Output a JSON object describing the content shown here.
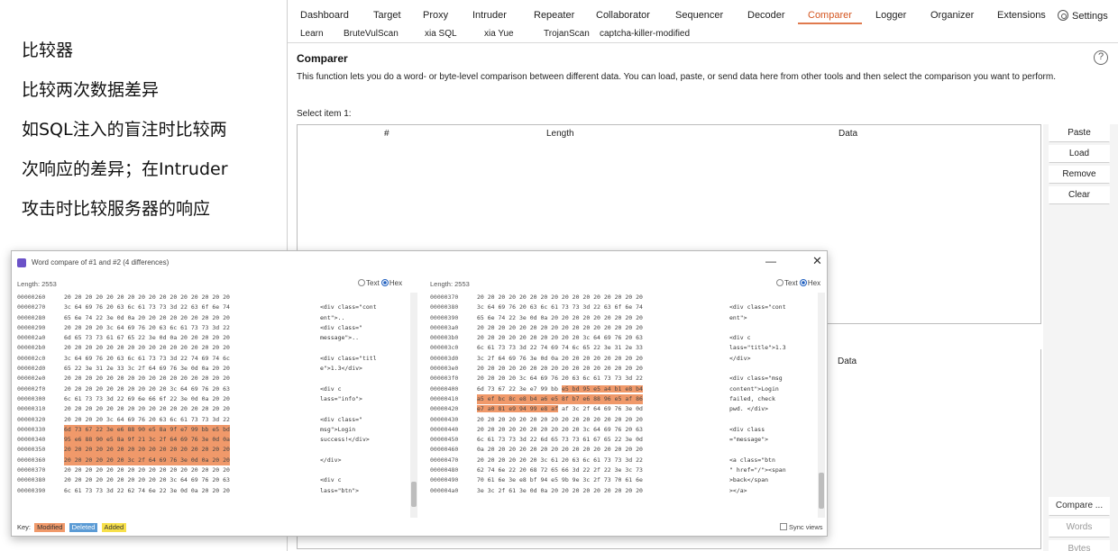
{
  "annotation": {
    "lines": [
      "比较器",
      "比较两次数据差异",
      "如SQL注入的盲注时比较两",
      "次响应的差异；在Intruder",
      "攻击时比较服务器的响应"
    ]
  },
  "tabs_row1": [
    {
      "label": "Dashboard"
    },
    {
      "label": "Target"
    },
    {
      "label": "Proxy"
    },
    {
      "label": "Intruder"
    },
    {
      "label": "Repeater"
    },
    {
      "label": "Collaborator"
    },
    {
      "label": "Sequencer"
    },
    {
      "label": "Decoder"
    },
    {
      "label": "Comparer"
    },
    {
      "label": "Logger"
    },
    {
      "label": "Organizer"
    },
    {
      "label": "Extensions"
    }
  ],
  "active_tab": "Comparer",
  "settings_label": "Settings",
  "tabs_row2": [
    {
      "label": "Learn"
    },
    {
      "label": "BruteVulScan"
    },
    {
      "label": "xia SQL"
    },
    {
      "label": "xia Yue"
    },
    {
      "label": "TrojanScan"
    },
    {
      "label": "captcha-killer-modified"
    }
  ],
  "comparer": {
    "title": "Comparer",
    "description": "This function lets you do a word- or byte-level comparison between different data. You can load, paste, or send data here from other tools and then select the comparison you want to perform.",
    "select_item1_label": "Select item 1:",
    "columns": {
      "num": "#",
      "length": "Length",
      "data": "Data"
    },
    "item2_data_header": "Data",
    "buttons": {
      "paste": "Paste",
      "load": "Load",
      "remove": "Remove",
      "clear": "Clear"
    },
    "compare_label": "Compare ...",
    "words_label": "Words",
    "bytes_label": "Bytes"
  },
  "dialog": {
    "title": "Word compare of #1 and #2 (4 differences)",
    "minimize_glyph": "—",
    "close_glyph": "✕",
    "left": {
      "length_label": "Length: 2553",
      "text_label": "Text",
      "hex_label": "Hex",
      "rows": [
        {
          "off": "00000260",
          "hex": "20 20 20 20 20 20 20 20   20 20 20 20 20 20 20 20",
          "asc": "",
          "hl": false
        },
        {
          "off": "00000270",
          "hex": "3c 64 69 76 20 63 6c 61   73 73 3d 22 63 6f 6e 74",
          "asc": "<div class=\"cont",
          "hl": false
        },
        {
          "off": "00000280",
          "hex": "65 6e 74 22 3e 0d 0a 20   20 20 20 20 20 20 20 20",
          "asc": "ent\">..",
          "hl": false
        },
        {
          "off": "00000290",
          "hex": "20 20 20 20 3c 64 69 76   20 63 6c 61 73 73 3d 22",
          "asc": "    <div class=\"",
          "hl": false
        },
        {
          "off": "000002a0",
          "hex": "6d 65 73 73 61 67 65 22   3e 0d 0a 20 20 20 20 20",
          "asc": "message\">..",
          "hl": false
        },
        {
          "off": "000002b0",
          "hex": "20 20 20 20 20 20 20 20   20 20 20 20 20 20 20 20",
          "asc": "",
          "hl": false
        },
        {
          "off": "000002c0",
          "hex": "3c 64 69 76 20 63 6c 61   73 73 3d 22 74 69 74 6c",
          "asc": "<div class=\"titl",
          "hl": false
        },
        {
          "off": "000002d0",
          "hex": "65 22 3e 31 2e 33 3c 2f   64 69 76 3e 0d 0a 20 20",
          "asc": "e\">1.3</div>",
          "hl": false
        },
        {
          "off": "000002e0",
          "hex": "20 20 20 20 20 20 20 20   20 20 20 20 20 20 20 20",
          "asc": "",
          "hl": false
        },
        {
          "off": "000002f0",
          "hex": "20 20 20 20 20 20 20 20   20 20 3c 64 69 76 20 63",
          "asc": "          <div c",
          "hl": false
        },
        {
          "off": "00000300",
          "hex": "6c 61 73 73 3d 22 69 6e   66 6f 22 3e 0d 0a 20 20",
          "asc": "lass=\"info\">",
          "hl": false
        },
        {
          "off": "00000310",
          "hex": "20 20 20 20 20 20 20 20   20 20 20 20 20 20 20 20",
          "asc": "",
          "hl": false
        },
        {
          "off": "00000320",
          "hex": "20 20 20 20 3c 64 69 76   20 63 6c 61 73 73 3d 22",
          "asc": "    <div class=\"",
          "hl": false
        },
        {
          "off": "00000330",
          "hex": "6d 73 67 22 3e e6 88 90   e5 8a 9f e7 99 bb e5 bd",
          "asc": "msg\">Login",
          "hl": true
        },
        {
          "off": "00000340",
          "hex": "95 e6 88 90 e5 8a 9f 21   3c 2f 64 69 76 3e 0d 0a",
          "asc": "success!</div>",
          "hl": true
        },
        {
          "off": "00000350",
          "hex": "20 20 20 20 20 20 20 20   20 20 20 20 20 20 20 20",
          "asc": "",
          "hl": true
        },
        {
          "off": "00000360",
          "hex": "20 20 20 20 20 20 3c 2f   64 69 76 3e 0d 0a 20 20",
          "asc": "      </div>",
          "hl": true
        },
        {
          "off": "00000370",
          "hex": "20 20 20 20 20 20 20 20   20 20 20 20 20 20 20 20",
          "asc": "",
          "hl": false
        },
        {
          "off": "00000380",
          "hex": "20 20 20 20 20 20 20 20   20 20 3c 64 69 76 20 63",
          "asc": "          <div c",
          "hl": false
        },
        {
          "off": "00000390",
          "hex": "6c 61 73 73 3d 22 62 74   6e 22 3e 0d 0a 20 20 20",
          "asc": "lass=\"btn\">",
          "hl": false
        }
      ]
    },
    "right": {
      "length_label": "Length: 2553",
      "text_label": "Text",
      "hex_label": "Hex",
      "rows": [
        {
          "off": "00000370",
          "hex": "20 20 20 20 20 20 20 20   20 20 20 20 20 20 20 20",
          "asc": "",
          "hl": "none"
        },
        {
          "off": "00000380",
          "hex": "3c 64 69 76 20 63 6c 61   73 73 3d 22 63 6f 6e 74",
          "asc": "<div class=\"cont",
          "hl": "none"
        },
        {
          "off": "00000390",
          "hex": "65 6e 74 22 3e 0d 0a 20   20 20 20 20 20 20 20 20",
          "asc": "ent\">",
          "hl": "none"
        },
        {
          "off": "000003a0",
          "hex": "20 20 20 20 20 20 20 20   20 20 20 20 20 20 20 20",
          "asc": "",
          "hl": "none"
        },
        {
          "off": "000003b0",
          "hex": "20 20 20 20 20 20 20 20   20 20 3c 64 69 76 20 63",
          "asc": "          <div c",
          "hl": "none"
        },
        {
          "off": "000003c0",
          "hex": "6c 61 73 73 3d 22 74 69   74 6c 65 22 3e 31 2e 33",
          "asc": "lass=\"title\">1.3",
          "hl": "none"
        },
        {
          "off": "000003d0",
          "hex": "3c 2f 64 69 76 3e 0d 0a   20 20 20 20 20 20 20 20",
          "asc": "</div>",
          "hl": "none"
        },
        {
          "off": "000003e0",
          "hex": "20 20 20 20 20 20 20 20   20 20 20 20 20 20 20 20",
          "asc": "",
          "hl": "none"
        },
        {
          "off": "000003f0",
          "hex": "20 20 20 20 3c 64 69 76   20 63 6c 61 73 73 3d 22",
          "asc": "<div class=\"msg",
          "hl": "none"
        },
        {
          "off": "00000400",
          "hex": "6d 73 67 22 3e e7 99 bb   e5 bd 95 e5 a4 b1 e8 b4",
          "asc": "content\">Login",
          "hl": "right"
        },
        {
          "off": "00000410",
          "hex": "a5 ef bc 8c e8 b4 a6 e5   8f b7 e6 88 96 e5 af 86",
          "asc": "failed, check",
          "hl": "full"
        },
        {
          "off": "00000420",
          "hex": "e7 a0 81 e9 94 99 e8 af   af 3c 2f 64 69 76 3e 0d",
          "asc": "pwd. </div>",
          "hl": "left"
        },
        {
          "off": "00000430",
          "hex": "20 20 20 20 20 20 20 20   20 20 20 20 20 20 20 20",
          "asc": "",
          "hl": "none"
        },
        {
          "off": "00000440",
          "hex": "20 20 20 20 20 20 20 20   20 20 3c 64 69 76 20 63",
          "asc": "   <div class",
          "hl": "none"
        },
        {
          "off": "00000450",
          "hex": "6c 61 73 73 3d 22 6d 65   73 73 61 67 65 22 3e 0d",
          "asc": "=\"message\">",
          "hl": "none"
        },
        {
          "off": "00000460",
          "hex": "0a 20 20 20 20 20 20 20   20 20 20 20 20 20 20 20",
          "asc": "",
          "hl": "none"
        },
        {
          "off": "00000470",
          "hex": "20 20 20 20 20 20 3c 61   20 63 6c 61 73 73 3d 22",
          "asc": "  <a class=\"btn",
          "hl": "none"
        },
        {
          "off": "00000480",
          "hex": "62 74 6e 22 20 68 72 65   66 3d 22 2f 22 3e 3c 73",
          "asc": "\" href=\"/\"><span",
          "hl": "none"
        },
        {
          "off": "00000490",
          "hex": "70 61 6e 3e e8 bf 94 e5   9b 9e 3c 2f 73 70 61 6e",
          "asc": ">back</span",
          "hl": "none"
        },
        {
          "off": "000004a0",
          "hex": "3e 3c 2f 61 3e 0d 0a 20   20 20 20 20 20 20 20 20",
          "asc": "></a>",
          "hl": "none"
        }
      ]
    },
    "legend": {
      "key": "Key:",
      "modified": "Modified",
      "deleted": "Deleted",
      "added": "Added"
    },
    "sync_label": "Sync views"
  }
}
